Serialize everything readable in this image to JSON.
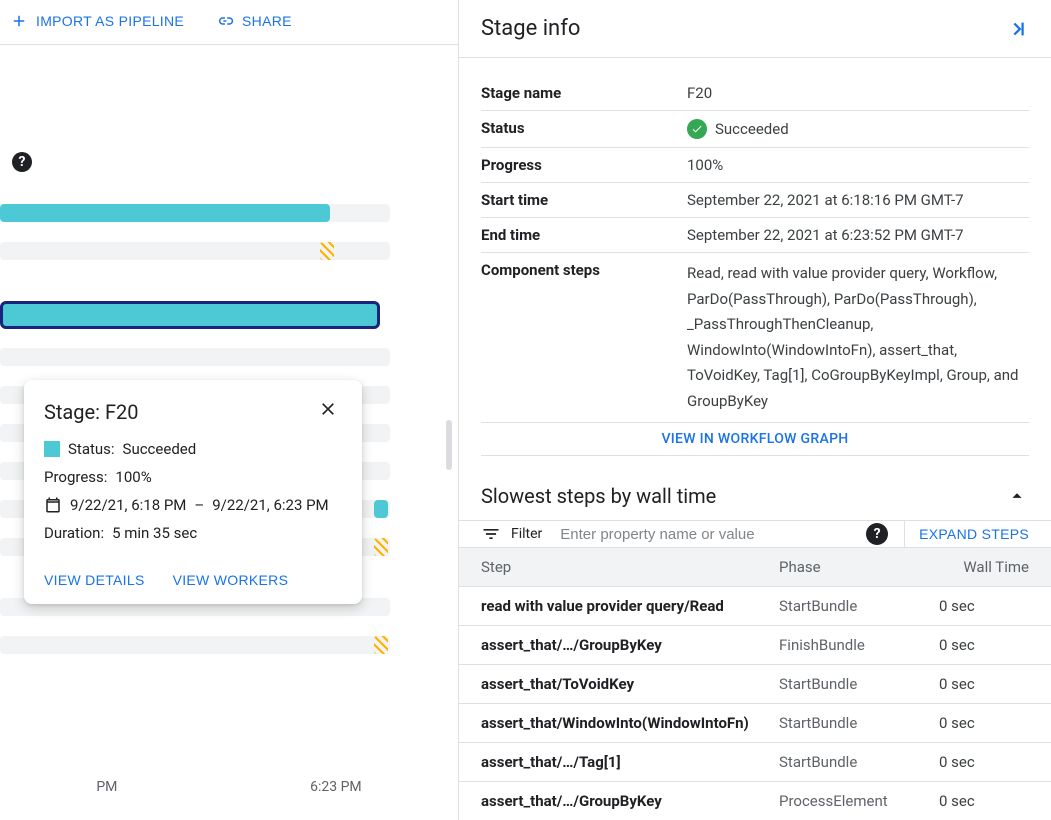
{
  "topbar": {
    "import_label": "IMPORT AS PIPELINE",
    "share_label": "SHARE"
  },
  "gantt": {
    "time_labels": [
      "PM",
      "6:23 PM"
    ]
  },
  "tooltip": {
    "title": "Stage: F20",
    "status_label": "Status:",
    "status_value": "Succeeded",
    "progress_label": "Progress:",
    "progress_value": "100%",
    "start_time": "9/22/21, 6:18 PM",
    "separator": "–",
    "end_time": "9/22/21, 6:23 PM",
    "duration_label": "Duration:",
    "duration_value": "5 min 35 sec",
    "view_details": "VIEW DETAILS",
    "view_workers": "VIEW WORKERS"
  },
  "panel": {
    "title": "Stage info",
    "rows": {
      "stage_name_label": "Stage name",
      "stage_name_value": "F20",
      "status_label": "Status",
      "status_value": "Succeeded",
      "progress_label": "Progress",
      "progress_value": "100%",
      "start_label": "Start time",
      "start_value": "September 22, 2021 at 6:18:16 PM GMT-7",
      "end_label": "End time",
      "end_value": "September 22, 2021 at 6:23:52 PM GMT-7",
      "components_label": "Component steps",
      "components_value": "Read, read with value provider query, Workflow, ParDo(PassThrough), ParDo(PassThrough), _PassThroughThenCleanup, WindowInto(WindowIntoFn), assert_that, ToVoidKey, Tag[1], CoGroupByKeyImpl, Group, and GroupByKey"
    },
    "view_workflow": "VIEW IN WORKFLOW GRAPH"
  },
  "slowest": {
    "title": "Slowest steps by wall time",
    "filter_label": "Filter",
    "filter_placeholder": "Enter property name or value",
    "expand_label": "EXPAND STEPS",
    "columns": {
      "step": "Step",
      "phase": "Phase",
      "wall": "Wall Time"
    },
    "rows": [
      {
        "step": "read with value provider query/Read",
        "phase": "StartBundle",
        "wall": "0 sec"
      },
      {
        "step": "assert_that/…/GroupByKey",
        "phase": "FinishBundle",
        "wall": "0 sec"
      },
      {
        "step": "assert_that/ToVoidKey",
        "phase": "StartBundle",
        "wall": "0 sec"
      },
      {
        "step": "assert_that/WindowInto(WindowIntoFn)",
        "phase": "StartBundle",
        "wall": "0 sec"
      },
      {
        "step": "assert_that/…/Tag[1]",
        "phase": "StartBundle",
        "wall": "0 sec"
      },
      {
        "step": "assert_that/…/GroupByKey",
        "phase": "ProcessElement",
        "wall": "0 sec"
      }
    ]
  }
}
